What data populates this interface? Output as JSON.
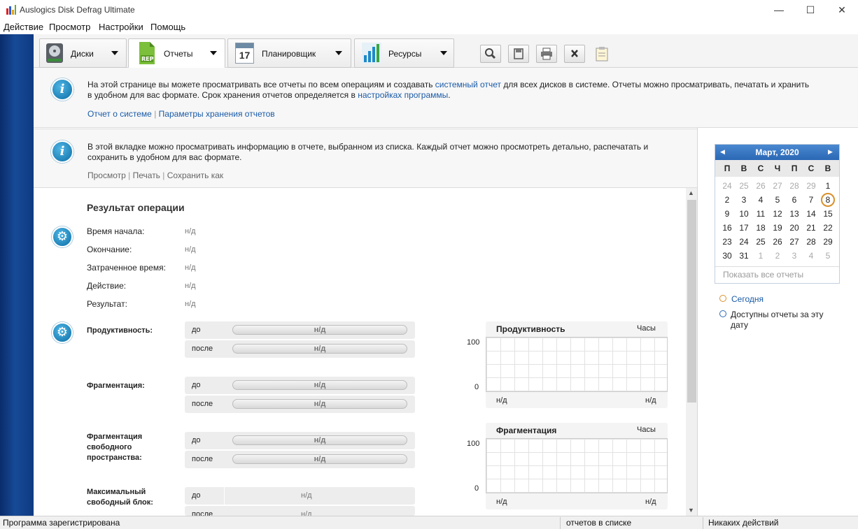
{
  "window": {
    "title": "Auslogics Disk Defrag Ultimate",
    "minimize": "—",
    "maximize": "☐",
    "close": "✕"
  },
  "menu": [
    "Действие",
    "Просмотр",
    "Настройки",
    "Помощь"
  ],
  "tabs": [
    {
      "label": "Диски",
      "icon": "disk-icon"
    },
    {
      "label": "Отчеты",
      "icon": "report-icon"
    },
    {
      "label": "Планировщик",
      "icon": "calendar-icon",
      "icon_text": "17"
    },
    {
      "label": "Ресурсы",
      "icon": "chart-icon"
    }
  ],
  "toolbar_icons": [
    "search-icon",
    "save-icon",
    "print-icon",
    "delete-icon",
    "clipboard-icon"
  ],
  "info1": {
    "text_a": "На этой странице вы можете просматривать все отчеты по всем операциям и создавать ",
    "link_a": "системный отчет",
    "text_b": " для всех дисков в системе. Отчеты можно просматривать, печатать и хранить в удобном для вас формате. Срок хранения отчетов определяется в ",
    "link_b": "настройках программы",
    "text_c": ".",
    "link_system": "Отчет о системе",
    "link_storage": "Параметры хранения отчетов",
    "separator": "|"
  },
  "info2": {
    "text": "В этой вкладке можно просматривать информацию в отчете, выбранном из списка. Каждый отчет можно просмотреть детально, распечатать и сохранить в удобном для вас формате.",
    "view": "Просмотр",
    "print": "Печать",
    "save_as": "Сохранить как",
    "separator": "|"
  },
  "result": {
    "title": "Результат операции",
    "rows": [
      {
        "label": "Время начала:",
        "value": "н/д"
      },
      {
        "label": "Окончание:",
        "value": "н/д"
      },
      {
        "label": "Затраченное время:",
        "value": "н/д"
      },
      {
        "label": "Действие:",
        "value": "н/д"
      },
      {
        "label": "Результат:",
        "value": "н/д"
      }
    ]
  },
  "metrics": [
    {
      "label": "Продуктивность:",
      "before": "до",
      "after": "после",
      "before_value": "н/д",
      "after_value": "н/д"
    },
    {
      "label": "Фрагментация:",
      "before": "до",
      "after": "после",
      "before_value": "н/д",
      "after_value": "н/д"
    },
    {
      "label": "Фрагментация свободного пространства:",
      "before": "до",
      "after": "после",
      "before_value": "н/д",
      "after_value": "н/д"
    },
    {
      "label": "Максимальный свободный блок:",
      "before": "до",
      "after": "после",
      "before_value": "н/д",
      "after_value": "н/д"
    }
  ],
  "charts": [
    {
      "title": "Продуктивность",
      "unit": "Часы",
      "y_max": "100",
      "y_min": "0",
      "x_start": "н/д",
      "x_end": "н/д"
    },
    {
      "title": "Фрагментация",
      "unit": "Часы",
      "y_max": "100",
      "y_min": "0",
      "x_start": "н/д",
      "x_end": "н/д"
    }
  ],
  "calendar": {
    "month": "Март, 2020",
    "prev": "◀",
    "next": "▶",
    "dow": [
      "П",
      "В",
      "С",
      "Ч",
      "П",
      "С",
      "В"
    ],
    "weeks": [
      [
        "24",
        "25",
        "26",
        "27",
        "28",
        "29",
        "1"
      ],
      [
        "2",
        "3",
        "4",
        "5",
        "6",
        "7",
        "8"
      ],
      [
        "9",
        "10",
        "11",
        "12",
        "13",
        "14",
        "15"
      ],
      [
        "16",
        "17",
        "18",
        "19",
        "20",
        "21",
        "22"
      ],
      [
        "23",
        "24",
        "25",
        "26",
        "27",
        "28",
        "29"
      ],
      [
        "30",
        "31",
        "1",
        "2",
        "3",
        "4",
        "5"
      ]
    ],
    "selected": "8",
    "show_all": "Показать все отчеты",
    "legend_today": "Сегодня",
    "legend_available": "Доступны отчеты за эту дату",
    "today_color": "#d9902c",
    "available_color": "#2b68b5"
  },
  "status": {
    "left": "Программа зарегистрирована",
    "middle": "отчетов в списке",
    "right": "Никаких действий"
  }
}
